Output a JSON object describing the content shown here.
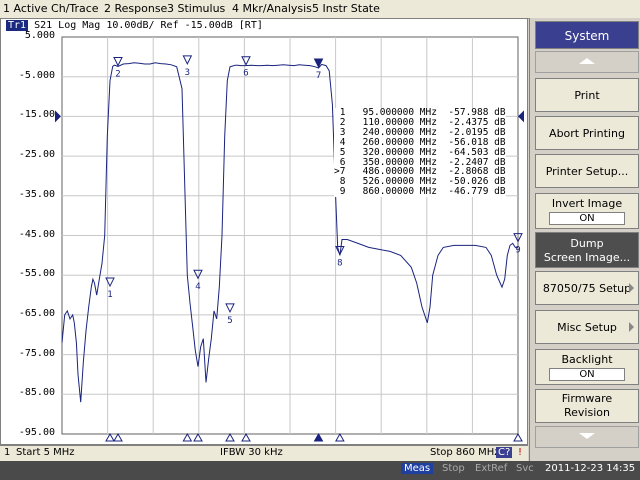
{
  "menu": {
    "items": [
      "1 Active Ch/Trace",
      "2 Response",
      "3 Stimulus",
      "4 Mkr/Analysis",
      "5 Instr State"
    ]
  },
  "trace": {
    "id": "Tr1",
    "description": "S21 Log Mag 10.00dB/ Ref -15.00dB [RT]"
  },
  "chart_data": {
    "type": "line",
    "xlabel": "",
    "ylabel": "",
    "xlim": [
      5,
      860
    ],
    "ylim": [
      -95,
      5
    ],
    "y_ticks": [
      "5.000",
      "-5.000",
      "-15.00",
      "-25.00",
      "-35.00",
      "-45.00",
      "-55.00",
      "-65.00",
      "-75.00",
      "-85.00",
      "-95.00"
    ],
    "reference_level": -15,
    "series": [
      {
        "name": "S21",
        "color": "#1a237e",
        "x": [
          5,
          10,
          15,
          20,
          25,
          28,
          32,
          35,
          40,
          45,
          50,
          55,
          60,
          63,
          66,
          70,
          75,
          80,
          85,
          90,
          95,
          100,
          103,
          106,
          110,
          120,
          130,
          140,
          150,
          160,
          170,
          180,
          190,
          200,
          210,
          220,
          230,
          240,
          245,
          250,
          255,
          260,
          265,
          270,
          275,
          280,
          285,
          290,
          295,
          300,
          305,
          310,
          315,
          320,
          325,
          330,
          335,
          340,
          345,
          350,
          360,
          370,
          380,
          390,
          400,
          410,
          420,
          430,
          440,
          450,
          460,
          470,
          480,
          486,
          492,
          500,
          506,
          512,
          518,
          522,
          526,
          530,
          540,
          560,
          580,
          600,
          620,
          640,
          660,
          670,
          680,
          690,
          695,
          700,
          710,
          720,
          740,
          760,
          780,
          800,
          810,
          820,
          830,
          835,
          840,
          845,
          850,
          855,
          860
        ],
        "values": [
          -72,
          -65,
          -64,
          -66,
          -65,
          -67,
          -72,
          -80,
          -87,
          -77,
          -69,
          -63,
          -58,
          -56,
          -57,
          -60,
          -56,
          -52,
          -45,
          -20,
          -6,
          -2.4,
          -2.1,
          -2.2,
          -2.4,
          -1.8,
          -1.7,
          -1.5,
          -1.6,
          -1.8,
          -1.8,
          -1.5,
          -1.7,
          -1.8,
          -2.0,
          -2.5,
          -8,
          -55,
          -62,
          -68,
          -74,
          -78,
          -73,
          -71,
          -82,
          -76,
          -71,
          -64,
          -66,
          -58,
          -45,
          -20,
          -6,
          -2.5,
          -2.3,
          -2.1,
          -2.1,
          -2.2,
          -2.2,
          -2.2,
          -2.1,
          -2.2,
          -2.2,
          -2.1,
          -2.2,
          -2.1,
          -2.0,
          -2.1,
          -2.2,
          -2.0,
          -2.1,
          -2.2,
          -2.5,
          -2.8,
          -1.9,
          -2.2,
          -3.5,
          -12,
          -35,
          -48,
          -50,
          -46,
          -46,
          -47,
          -48,
          -48.5,
          -49,
          -50,
          -53,
          -57,
          -63,
          -67,
          -63,
          -55,
          -50,
          -48,
          -47.5,
          -47.5,
          -47.5,
          -48,
          -50,
          -55,
          -58,
          -56,
          -50,
          -47.5,
          -47,
          -48,
          -48
        ]
      }
    ],
    "markers": [
      {
        "id": "1",
        "active": false,
        "freq": 95.0,
        "value": -57.988,
        "freq_text": "95.000000 MHz",
        "value_text": "-57.988 dB"
      },
      {
        "id": "2",
        "active": false,
        "freq": 110.0,
        "value": -2.4375,
        "freq_text": "110.00000 MHz",
        "value_text": "-2.4375 dB"
      },
      {
        "id": "3",
        "active": false,
        "freq": 240.0,
        "value": -2.0195,
        "freq_text": "240.00000 MHz",
        "value_text": "-2.0195 dB"
      },
      {
        "id": "4",
        "active": false,
        "freq": 260.0,
        "value": -56.018,
        "freq_text": "260.00000 MHz",
        "value_text": "-56.018 dB"
      },
      {
        "id": "5",
        "active": false,
        "freq": 320.0,
        "value": -64.503,
        "freq_text": "320.00000 MHz",
        "value_text": "-64.503 dB"
      },
      {
        "id": "6",
        "active": false,
        "freq": 350.0,
        "value": -2.2407,
        "freq_text": "350.00000 MHz",
        "value_text": "-2.2407 dB"
      },
      {
        "id": "7",
        "active": true,
        "freq": 486.0,
        "value": -2.8068,
        "freq_text": "486.00000 MHz",
        "value_text": "-2.8068 dB"
      },
      {
        "id": "8",
        "active": false,
        "freq": 526.0,
        "value": -50.026,
        "freq_text": "526.00000 MHz",
        "value_text": "-50.026 dB"
      },
      {
        "id": "9",
        "active": false,
        "freq": 860.0,
        "value": -46.779,
        "freq_text": "860.00000 MHz",
        "value_text": "-46.779 dB"
      }
    ]
  },
  "status": {
    "channel": "1",
    "start": "Start 5 MHz",
    "ifbw": "IFBW 30 kHz",
    "stop": "Stop 860 MHz",
    "c_badge": "C?",
    "end_mark": "!"
  },
  "bottom": {
    "meas": "Meas",
    "stop": "Stop",
    "extref": "ExtRef",
    "svc": "Svc",
    "datetime": "2011-12-23 14:35"
  },
  "side_panel": {
    "title": "System",
    "print": "Print",
    "abort": "Abort Printing",
    "printer_setup": "Printer Setup...",
    "invert_image": "Invert Image",
    "invert_state": "ON",
    "dump_line1": "Dump",
    "dump_line2": "Screen Image...",
    "model_setup": "87050/75 Setup",
    "misc_setup": "Misc Setup",
    "backlight": "Backlight",
    "backlight_state": "ON",
    "firmware_line1": "Firmware",
    "firmware_line2": "Revision"
  }
}
